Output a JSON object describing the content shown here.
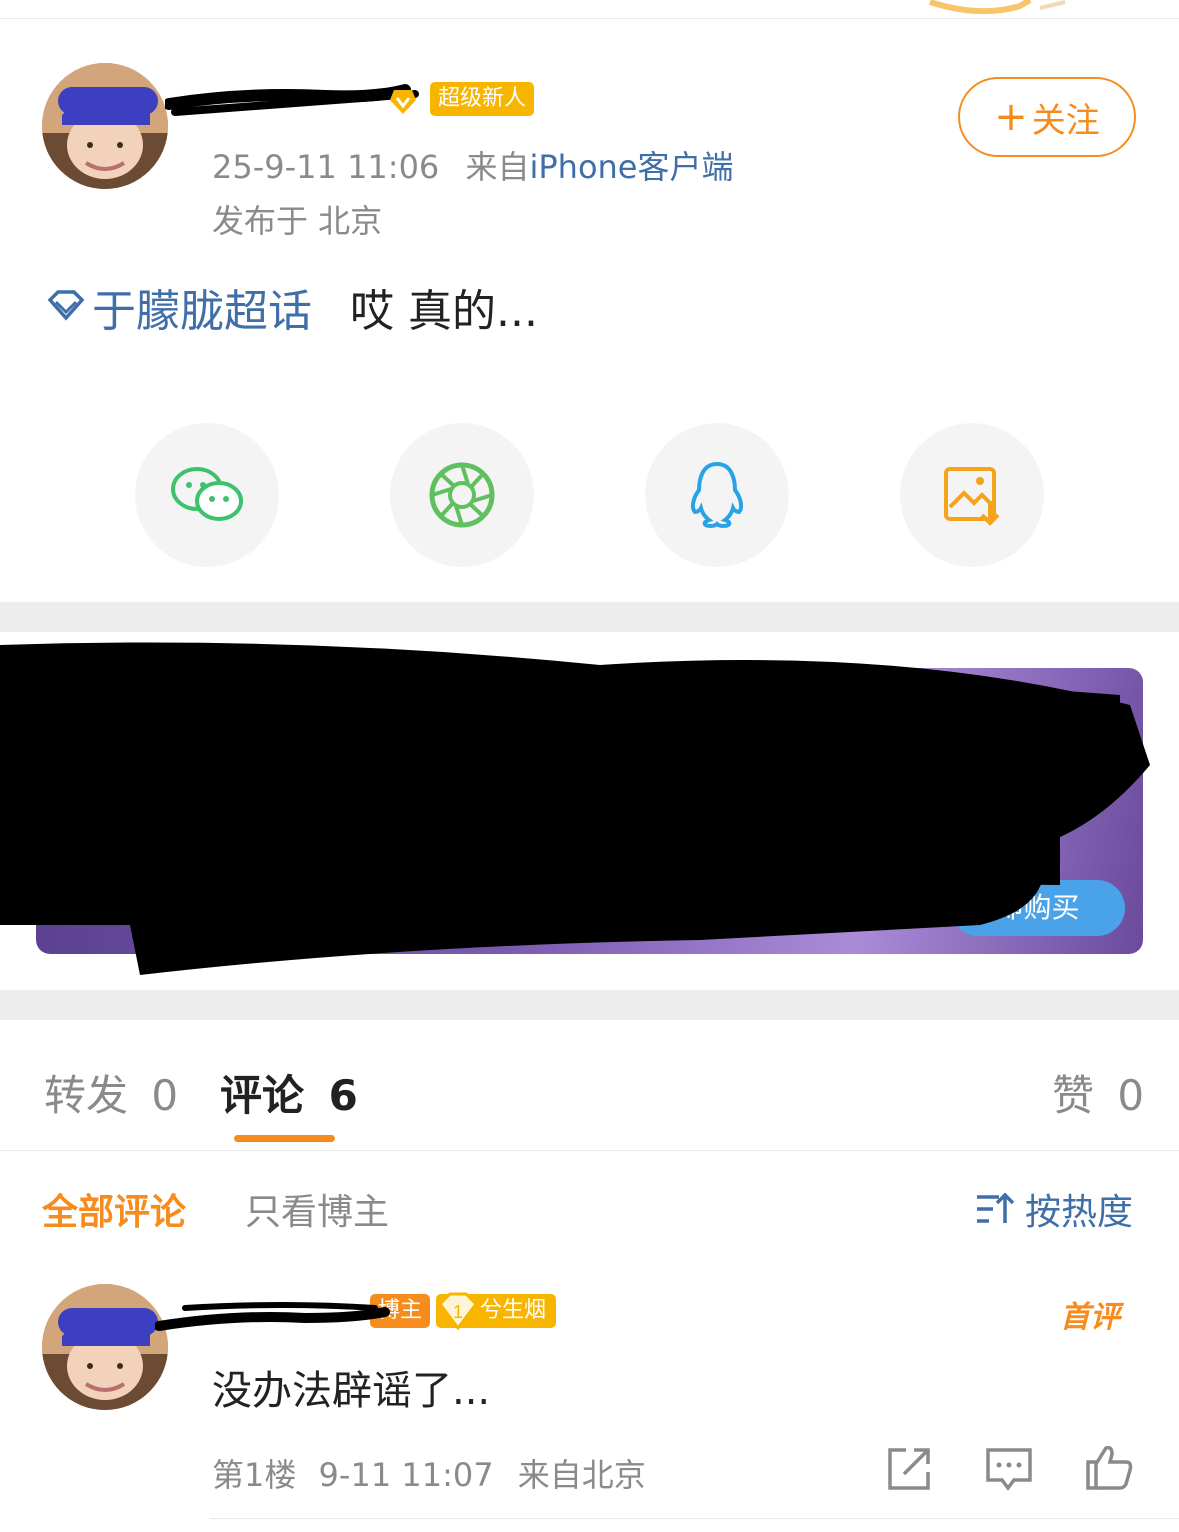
{
  "post": {
    "author_badge": "超级新人",
    "meta_line": "25-9-11 11:06",
    "source_prefix": "来自",
    "source": "iPhone客户端",
    "location": "发布于 北京",
    "topic": "于朦胧超话",
    "text": "哎 真的...",
    "follow_label": "关注",
    "follow_plus": "+"
  },
  "share": {
    "items": [
      {
        "name": "wechat-icon",
        "color": "#3dc26b"
      },
      {
        "name": "moments-icon",
        "color": "#5ec05e"
      },
      {
        "name": "qq-icon",
        "color": "#2aa3e6"
      },
      {
        "name": "save-image-icon",
        "color": "#f7a21b"
      }
    ]
  },
  "ad": {
    "button_label": "即购买"
  },
  "tabs": {
    "repost": {
      "label": "转发",
      "count": "0"
    },
    "comments": {
      "label": "评论",
      "count": "6"
    },
    "likes": {
      "label": "赞",
      "count": "0"
    }
  },
  "filters": {
    "all": "全部评论",
    "owner_only": "只看博主",
    "sort": "按热度"
  },
  "comment": {
    "owner_tag": "博主",
    "fan_level": "1",
    "fan_tag": "兮生烟",
    "first_label": "首评",
    "text": "没办法辟谣了...",
    "floor": "第1楼",
    "time": "9-11 11:07",
    "location": "来自北京"
  },
  "colors": {
    "accent": "#f78c1e",
    "link": "#3f6ea8",
    "badge_gold": "#f7b500"
  }
}
